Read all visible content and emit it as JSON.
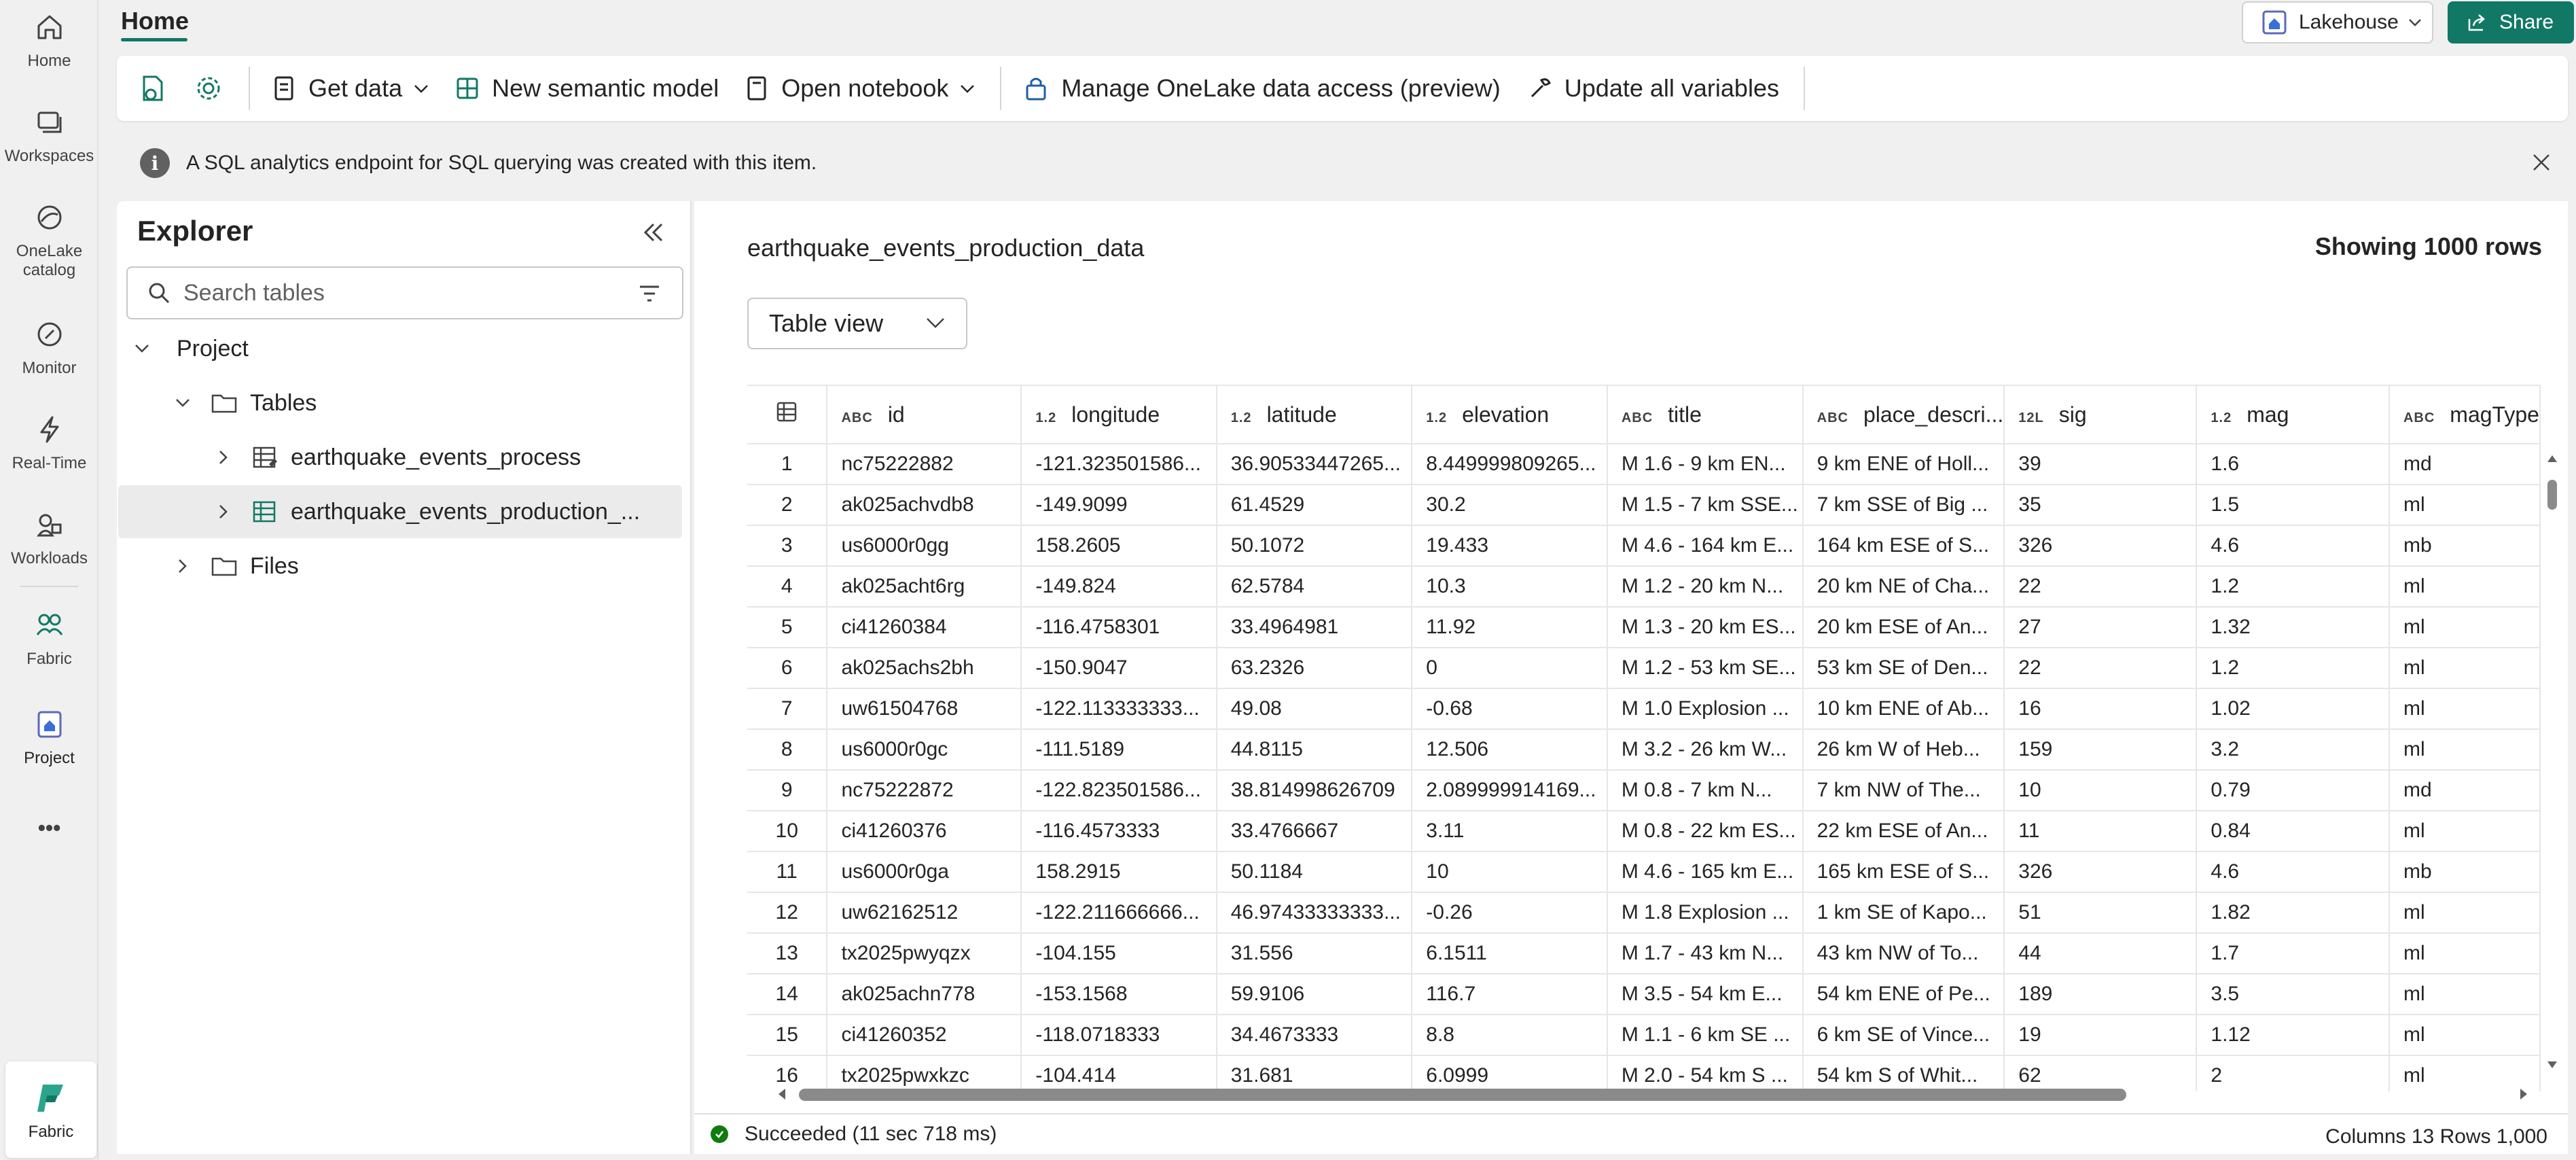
{
  "rail": {
    "items": [
      {
        "label": "Home",
        "icon": "home-icon"
      },
      {
        "label": "Workspaces",
        "icon": "workspaces-icon"
      },
      {
        "label": "OneLake\ncatalog",
        "icon": "onelake-catalog-icon"
      },
      {
        "label": "Monitor",
        "icon": "monitor-icon"
      },
      {
        "label": "Real-Time",
        "icon": "real-time-icon"
      },
      {
        "label": "Workloads",
        "icon": "workloads-icon"
      },
      {
        "label": "Fabric",
        "icon": "fabric-icon"
      },
      {
        "label": "Project",
        "icon": "project-icon"
      }
    ],
    "more": "•••",
    "bottom_label": "Fabric"
  },
  "header": {
    "tab": "Home",
    "lakehouse": "Lakehouse",
    "share": "Share",
    "accent": "#117865"
  },
  "toolbar": {
    "get_data": "Get data",
    "new_semantic_model": "New semantic model",
    "open_notebook": "Open notebook",
    "manage_access": "Manage OneLake data access (preview)",
    "update_variables": "Update all variables"
  },
  "banner": {
    "message": "A SQL analytics endpoint for SQL querying was created with this item."
  },
  "explorer": {
    "title": "Explorer",
    "search_placeholder": "Search tables",
    "tree": {
      "project": "Project",
      "tables": "Tables",
      "table1": "earthquake_events_process",
      "table2": "earthquake_events_production_...",
      "files": "Files"
    }
  },
  "content": {
    "table_name": "earthquake_events_production_data",
    "showing": "Showing 1000 rows",
    "view": "Table view",
    "columns": [
      {
        "type": "ABC",
        "name": "id"
      },
      {
        "type": "1.2",
        "name": "longitude"
      },
      {
        "type": "1.2",
        "name": "latitude"
      },
      {
        "type": "1.2",
        "name": "elevation"
      },
      {
        "type": "ABC",
        "name": "title"
      },
      {
        "type": "ABC",
        "name": "place_descri..."
      },
      {
        "type": "12L",
        "name": "sig"
      },
      {
        "type": "1.2",
        "name": "mag"
      },
      {
        "type": "ABC",
        "name": "magType"
      }
    ],
    "rows": [
      [
        "1",
        "nc75222882",
        "-121.323501586...",
        "36.90533447265...",
        "8.449999809265...",
        "M 1.6 - 9 km EN...",
        "9 km ENE of Holl...",
        "39",
        "1.6",
        "md"
      ],
      [
        "2",
        "ak025achvdb8",
        "-149.9099",
        "61.4529",
        "30.2",
        "M 1.5 - 7 km SSE...",
        "7 km SSE of Big ...",
        "35",
        "1.5",
        "ml"
      ],
      [
        "3",
        "us6000r0gg",
        "158.2605",
        "50.1072",
        "19.433",
        "M 4.6 - 164 km E...",
        "164 km ESE of S...",
        "326",
        "4.6",
        "mb"
      ],
      [
        "4",
        "ak025acht6rg",
        "-149.824",
        "62.5784",
        "10.3",
        "M 1.2 - 20 km N...",
        "20 km NE of Cha...",
        "22",
        "1.2",
        "ml"
      ],
      [
        "5",
        "ci41260384",
        "-116.4758301",
        "33.4964981",
        "11.92",
        "M 1.3 - 20 km ES...",
        "20 km ESE of An...",
        "27",
        "1.32",
        "ml"
      ],
      [
        "6",
        "ak025achs2bh",
        "-150.9047",
        "63.2326",
        "0",
        "M 1.2 - 53 km SE...",
        "53 km SE of Den...",
        "22",
        "1.2",
        "ml"
      ],
      [
        "7",
        "uw61504768",
        "-122.113333333...",
        "49.08",
        "-0.68",
        "M 1.0 Explosion ...",
        "10 km ENE of Ab...",
        "16",
        "1.02",
        "ml"
      ],
      [
        "8",
        "us6000r0gc",
        "-111.5189",
        "44.8115",
        "12.506",
        "M 3.2 - 26 km W...",
        "26 km W of Heb...",
        "159",
        "3.2",
        "ml"
      ],
      [
        "9",
        "nc75222872",
        "-122.823501586...",
        "38.814998626709",
        "2.089999914169...",
        "M 0.8 - 7 km N...",
        "7 km NW of The...",
        "10",
        "0.79",
        "md"
      ],
      [
        "10",
        "ci41260376",
        "-116.4573333",
        "33.4766667",
        "3.11",
        "M 0.8 - 22 km ES...",
        "22 km ESE of An...",
        "11",
        "0.84",
        "ml"
      ],
      [
        "11",
        "us6000r0ga",
        "158.2915",
        "50.1184",
        "10",
        "M 4.6 - 165 km E...",
        "165 km ESE of S...",
        "326",
        "4.6",
        "mb"
      ],
      [
        "12",
        "uw62162512",
        "-122.211666666...",
        "46.97433333333...",
        "-0.26",
        "M 1.8 Explosion ...",
        "1 km SE of Kapo...",
        "51",
        "1.82",
        "ml"
      ],
      [
        "13",
        "tx2025pwyqzx",
        "-104.155",
        "31.556",
        "6.1511",
        "M 1.7 - 43 km N...",
        "43 km NW of To...",
        "44",
        "1.7",
        "ml"
      ],
      [
        "14",
        "ak025achn778",
        "-153.1568",
        "59.9106",
        "116.7",
        "M 3.5 - 54 km E...",
        "54 km ENE of Pe...",
        "189",
        "3.5",
        "ml"
      ],
      [
        "15",
        "ci41260352",
        "-118.0718333",
        "34.4673333",
        "8.8",
        "M 1.1 - 6 km SE ...",
        "6 km SE of Vince...",
        "19",
        "1.12",
        "ml"
      ],
      [
        "16",
        "tx2025pwxkzc",
        "-104.414",
        "31.681",
        "6.0999",
        "M 2.0 - 54 km S ...",
        "54 km S of Whit...",
        "62",
        "2",
        "ml"
      ]
    ],
    "status": "Succeeded (11 sec 718 ms)",
    "summary": "Columns 13 Rows 1,000"
  }
}
